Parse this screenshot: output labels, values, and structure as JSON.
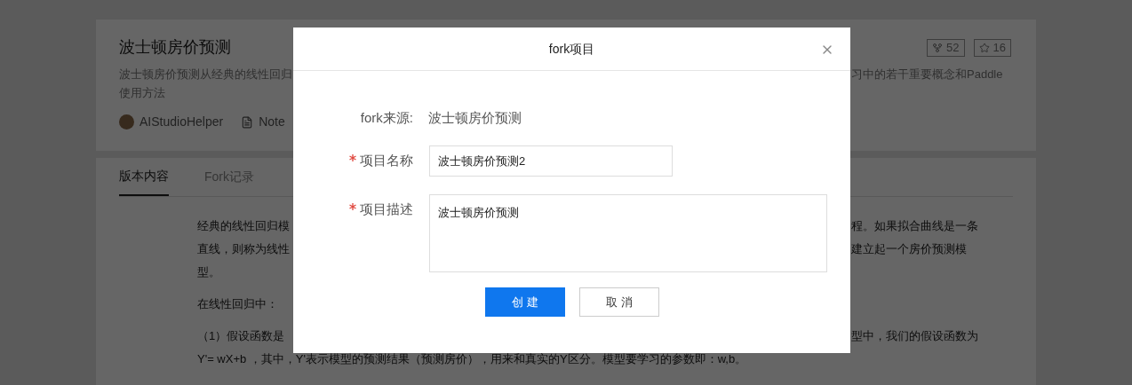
{
  "project": {
    "title": "波士顿房价预测",
    "description_lines": [
      {
        "start": "波士顿房价预测从经典的线性回归",
        "end": "习中的若干重要概念和Paddle"
      },
      {
        "start": "使用方法"
      }
    ],
    "author": "AIStudioHelper",
    "type_label": "Note",
    "fork_count": "52",
    "star_count": "16"
  },
  "tabs": [
    {
      "label": "版本内容",
      "selected": true
    },
    {
      "label": "Fork记录",
      "selected": false
    }
  ],
  "content": [
    {
      "lines": [
        {
          "start": "经典的线性回归模",
          "end": "程。如果拟合曲线是一条"
        },
        {
          "start": "直线，则称为线性",
          "end": "建立起一个房价预测模"
        },
        {
          "start": "型。"
        }
      ]
    },
    {
      "lines": [
        {
          "start": "在线性回归中："
        }
      ]
    },
    {
      "lines": [
        {
          "start": "（1）假设函数是",
          "end": "型中，我们的假设函数为"
        },
        {
          "start": "Y'= wX+b ，其中，Y'表示模型的预测结果（预测房价），用来和真实的Y区分。模型要学习的参数即：w,b。"
        }
      ]
    }
  ],
  "modal": {
    "title": "fork项目",
    "source_label": "fork来源:",
    "source_value": "波士顿房价预测",
    "fields": [
      {
        "kind": "input",
        "label": "项目名称",
        "required": true,
        "value": "波士顿房价预测2"
      },
      {
        "kind": "textarea",
        "label": "项目描述",
        "required": true,
        "value": "波士顿房价预测"
      }
    ],
    "buttons": [
      {
        "kind": "primary",
        "label": "创 建"
      },
      {
        "kind": "secondary",
        "label": "取 消"
      }
    ]
  }
}
